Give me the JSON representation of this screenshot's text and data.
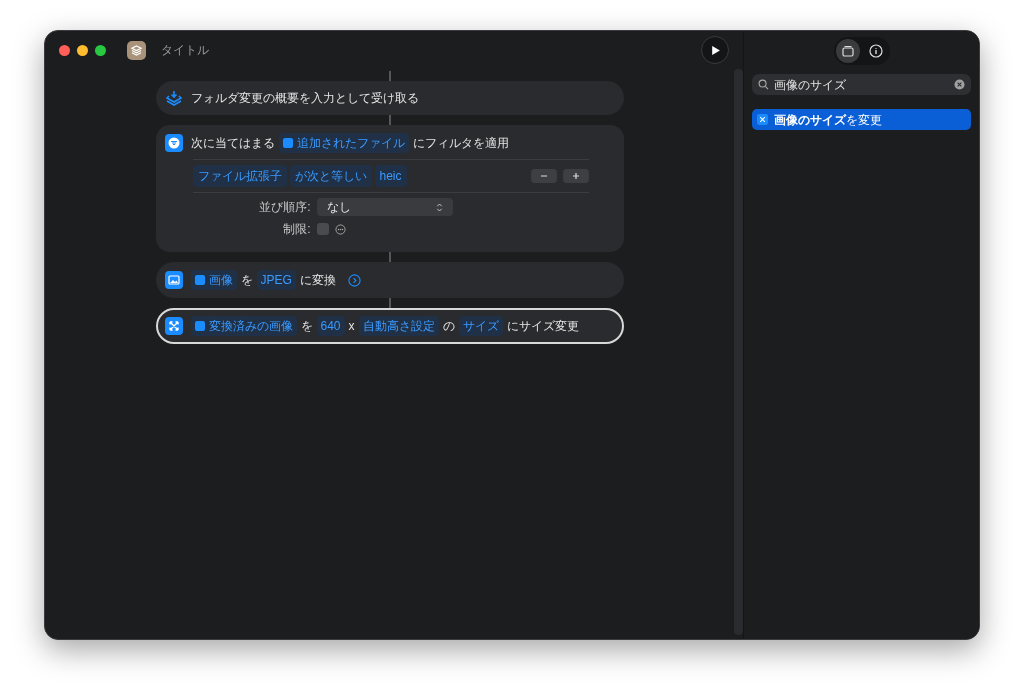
{
  "window": {
    "title": "タイトル"
  },
  "actions": [
    {
      "kind": "simple",
      "selected": false,
      "parts": [
        {
          "kind": "text",
          "text": "フォルダ変更の概要を入力として受け取る"
        }
      ]
    },
    {
      "kind": "filter",
      "selected": false,
      "parts": [
        {
          "kind": "text",
          "text": "次に当てはまる"
        },
        {
          "kind": "token",
          "text": "追加されたファイル",
          "variable": true
        },
        {
          "kind": "text",
          "text": "にフィルタを適用"
        }
      ],
      "condition": [
        "ファイル拡張子",
        "が次と等しい",
        "heic"
      ],
      "sort": {
        "label": "並び順序:",
        "value": "なし"
      },
      "limit": {
        "label": "制限:",
        "checked": false
      }
    },
    {
      "kind": "convert",
      "selected": false,
      "parts": [
        {
          "kind": "token",
          "text": "画像",
          "variable": true
        },
        {
          "kind": "text",
          "text": "を"
        },
        {
          "kind": "token",
          "text": "JPEG"
        },
        {
          "kind": "text",
          "text": "に変換"
        }
      ]
    },
    {
      "kind": "resize",
      "selected": true,
      "parts": [
        {
          "kind": "token",
          "text": "変換済みの画像",
          "variable": true
        },
        {
          "kind": "text",
          "text": "を"
        },
        {
          "kind": "token",
          "text": "640"
        },
        {
          "kind": "text",
          "text": "x"
        },
        {
          "kind": "token",
          "text": "自動高さ設定"
        },
        {
          "kind": "text",
          "text": "の"
        },
        {
          "kind": "token",
          "text": "サイズ"
        },
        {
          "kind": "text",
          "text": "にサイズ変更"
        }
      ]
    }
  ],
  "sidebar": {
    "tabs": [
      {
        "kind": "library",
        "selected": true
      },
      {
        "kind": "info",
        "selected": false
      }
    ],
    "search": {
      "value": "画像のサイズ"
    },
    "results": [
      {
        "label": "**画像のサイズ**を変更",
        "selected": true
      }
    ]
  }
}
